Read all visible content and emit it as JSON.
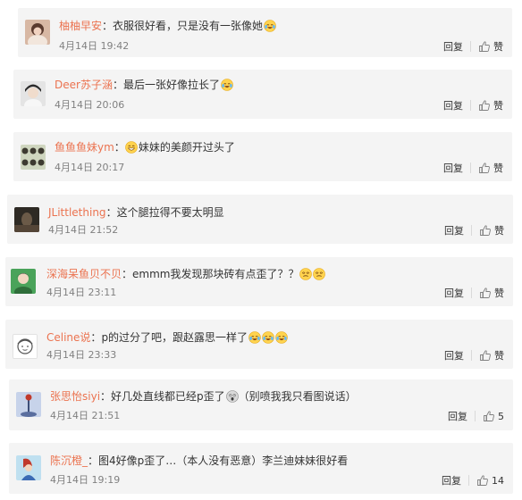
{
  "actions": {
    "reply_label": "回复",
    "like_label": "赞"
  },
  "comments": [
    {
      "user": "柚柚早安",
      "sep": "：",
      "text": "衣服很好看，只是没有一张像她",
      "emoji": [
        "laugh-cry-emoji"
      ],
      "time": "4月14日 19:42",
      "like_count": "",
      "avatar_color": "#c9a08a"
    },
    {
      "user": "Deer苏子涵",
      "sep": "：",
      "text": "最后一张好像拉长了",
      "emoji": [
        "laugh-cry-emoji"
      ],
      "time": "4月14日 20:06",
      "like_count": "",
      "avatar_color": "#b7b7b7"
    },
    {
      "user": "鱼鱼鱼妹ym",
      "sep": "：",
      "pre_emoji": [
        "grin-emoji"
      ],
      "text": "妹妹的美颜开过头了",
      "emoji": [],
      "time": "4月14日 20:17",
      "like_count": "",
      "avatar_color": "#7f8c5e"
    },
    {
      "user": "JLittlething",
      "sep": "：",
      "text": "这个腿拉得不要太明显",
      "emoji": [],
      "time": "4月14日 21:52",
      "like_count": "",
      "avatar_color": "#3a332c"
    },
    {
      "user": "深海呆鱼贝不贝",
      "sep": "：",
      "text": "emmm我发现那块砖有点歪了？？",
      "emoji": [
        "dizzy-emoji",
        "dizzy-emoji"
      ],
      "time": "4月14日 23:11",
      "like_count": "",
      "avatar_color": "#4aa35a"
    },
    {
      "user": "Celine说",
      "sep": "：",
      "text": "p的过分了吧，跟赵露思一样了",
      "emoji": [
        "laugh-cry-emoji",
        "laugh-cry-emoji",
        "laugh-cry-emoji"
      ],
      "time": "4月14日 23:33",
      "like_count": "",
      "avatar_color": "#ffffff"
    },
    {
      "user": "张思怡siyi",
      "sep": "：",
      "text": "好几处直线都已经p歪了",
      "emoji": [
        "shock-emoji"
      ],
      "text_after": "（别喷我我只看图说话）",
      "time": "4月14日 21:51",
      "like_count": "5",
      "avatar_color": "#8aa0c8"
    },
    {
      "user": "陈沉橙_",
      "sep": "：",
      "text": "图4好像p歪了…（本人没有恶意）李兰迪妹妹很好看",
      "emoji": [],
      "time": "4月14日 19:19",
      "like_count": "14",
      "avatar_color": "#3b6bb4"
    }
  ]
}
